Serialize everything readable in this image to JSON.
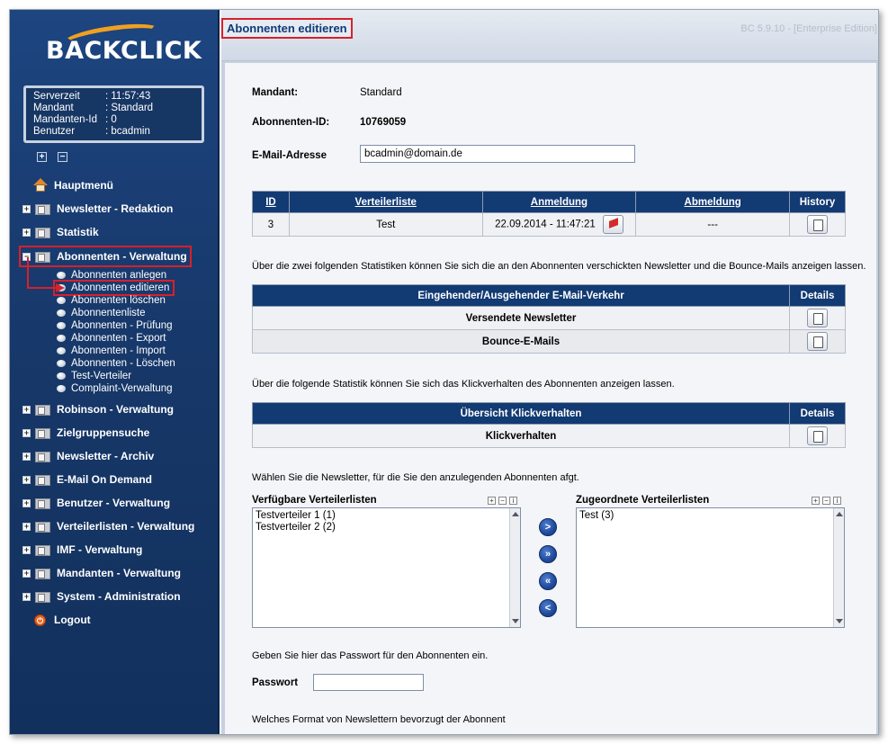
{
  "brand": {
    "logo_text": "BACKCLICK"
  },
  "server": {
    "rows": [
      {
        "key": "Serverzeit",
        "val": ": 11:57:43"
      },
      {
        "key": "Mandant",
        "val": ": Standard"
      },
      {
        "key": "Mandanten-Id",
        "val": ": 0"
      },
      {
        "key": "Benutzer",
        "val": ": bcadmin"
      }
    ]
  },
  "nav": {
    "home": "Hauptmenü",
    "items": [
      "Newsletter - Redaktion",
      "Statistik",
      "Abonnenten - Verwaltung",
      "Robinson - Verwaltung",
      "Zielgruppensuche",
      "Newsletter - Archiv",
      "E-Mail On Demand",
      "Benutzer - Verwaltung",
      "Verteilerlisten - Verwaltung",
      "IMF - Verwaltung",
      "Mandanten - Verwaltung",
      "System - Administration"
    ],
    "logout": "Logout",
    "sub": [
      "Abonnenten anlegen",
      "Abonnenten editieren",
      "Abonnenten löschen",
      "Abonnentenliste",
      "Abonnenten - Prüfung",
      "Abonnenten - Export",
      "Abonnenten - Import",
      "Abonnenten - Löschen",
      "Test-Verteiler",
      "Complaint-Verwaltung"
    ]
  },
  "header": {
    "title": "Abonnenten editieren",
    "version": "BC 5.9.10 - [Enterprise Edition]"
  },
  "form": {
    "mandant_label": "Mandant:",
    "mandant_value": "Standard",
    "id_label": "Abonnenten-ID:",
    "id_value": "10769059",
    "email_label": "E-Mail-Adresse",
    "email_value": "bcadmin@domain.de"
  },
  "subs_table": {
    "headers": [
      "ID",
      "Verteilerliste",
      "Anmeldung",
      "Abmeldung",
      "History"
    ],
    "row": {
      "id": "3",
      "liste": "Test",
      "anmeldung": "22.09.2014 - 11:47:21",
      "abmeldung": "---"
    }
  },
  "stats": {
    "intro": "Über die zwei folgenden Statistiken können Sie sich die an den Abonnenten verschickten Newsletter und die Bounce-Mails anzeigen lassen.",
    "header": "Eingehender/Ausgehender E-Mail-Verkehr",
    "details": "Details",
    "rows": [
      "Versendete Newsletter",
      "Bounce-E-Mails"
    ]
  },
  "clicks": {
    "intro": "Über die folgende Statistik können Sie sich das Klickverhalten des Abonnenten anzeigen lassen.",
    "header": "Übersicht Klickverhalten",
    "details": "Details",
    "row": "Klickverhalten"
  },
  "lists": {
    "intro": "Wählen Sie die Newsletter, für die Sie den anzulegenden Abonnenten afgt.",
    "available_title": "Verfügbare Verteilerlisten",
    "available": [
      "Testverteiler 1 (1)",
      "Testverteiler 2 (2)"
    ],
    "assigned_title": "Zugeordnete Verteilerlisten",
    "assigned": [
      "Test (3)"
    ],
    "buttons": [
      ">",
      "»",
      "«",
      "<"
    ]
  },
  "password": {
    "intro": "Geben Sie hier das Passwort für den Abonnenten ein.",
    "label": "Passwort"
  },
  "format": {
    "intro": "Welches Format von Newslettern bevorzugt der Abonnent"
  }
}
